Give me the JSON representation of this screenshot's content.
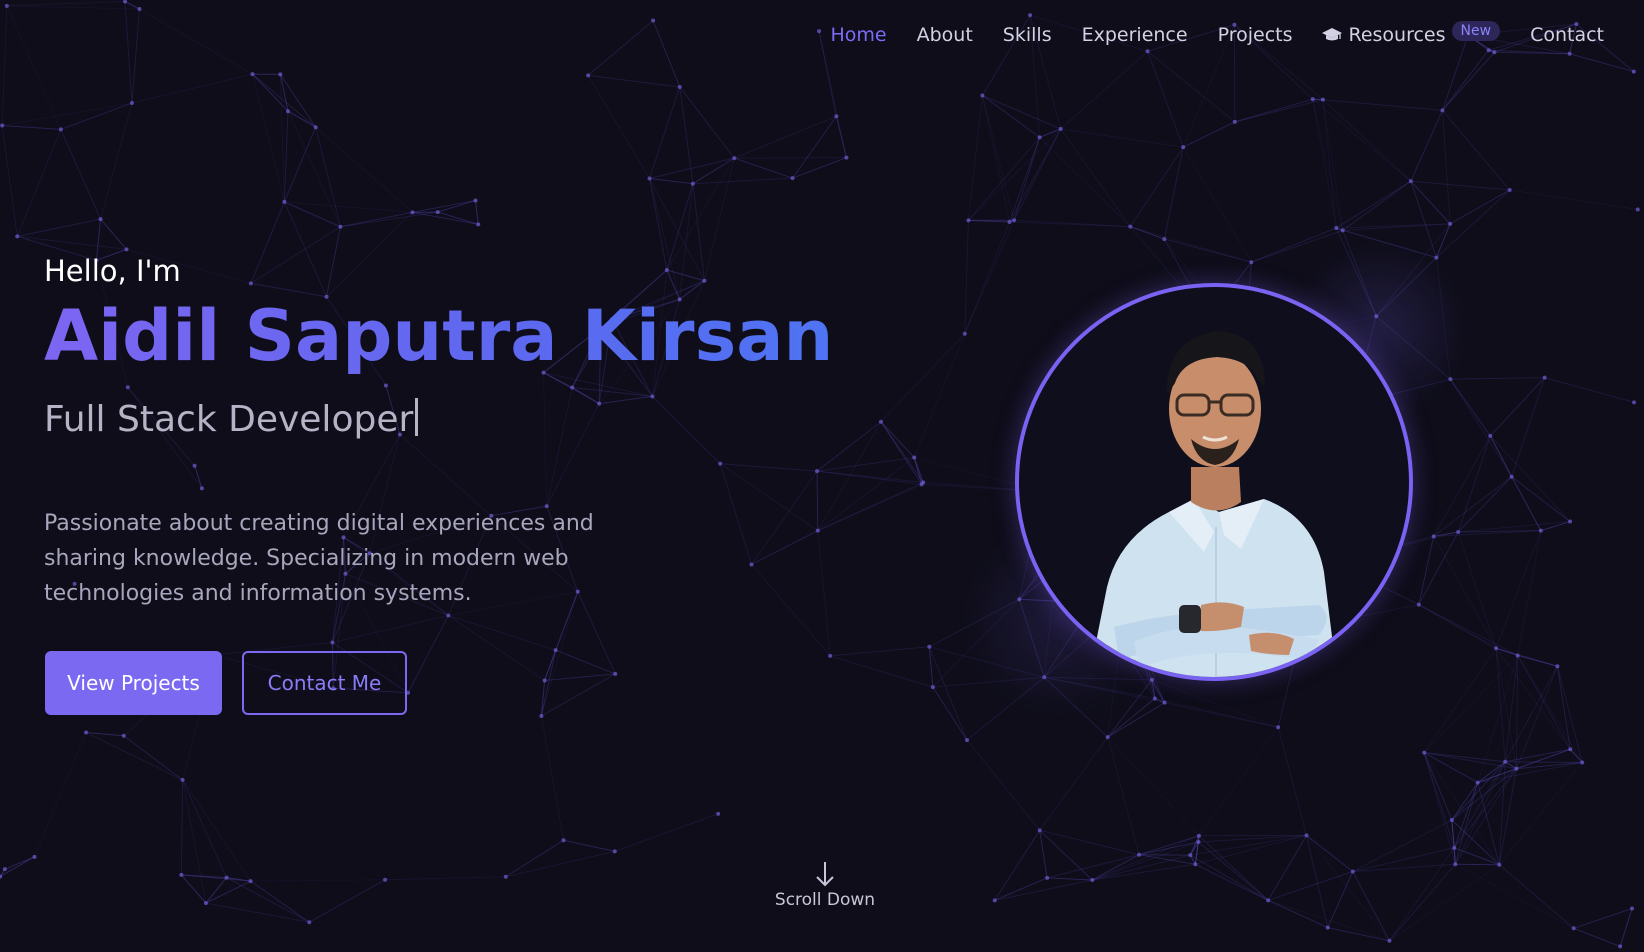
{
  "nav": {
    "items": [
      {
        "label": "Home",
        "active": true
      },
      {
        "label": "About"
      },
      {
        "label": "Skills"
      },
      {
        "label": "Experience"
      },
      {
        "label": "Projects"
      },
      {
        "label": "Resources",
        "icon": "graduation-cap-icon",
        "badge": "New"
      },
      {
        "label": "Contact"
      }
    ]
  },
  "hero": {
    "greeting": "Hello, I'm",
    "name": "Aidil Saputra Kirsan",
    "role": "Full Stack Developer",
    "description": "Passionate about creating digital experiences and sharing knowledge. Specializing in modern web technologies and information systems.",
    "primary_button": "View Projects",
    "secondary_button": "Contact Me"
  },
  "scroll": {
    "label": "Scroll Down",
    "icon": "arrow-down-icon"
  },
  "colors": {
    "background": "#0e0d19",
    "accent": "#7b69f2",
    "network_line": "#4b3f9e"
  }
}
